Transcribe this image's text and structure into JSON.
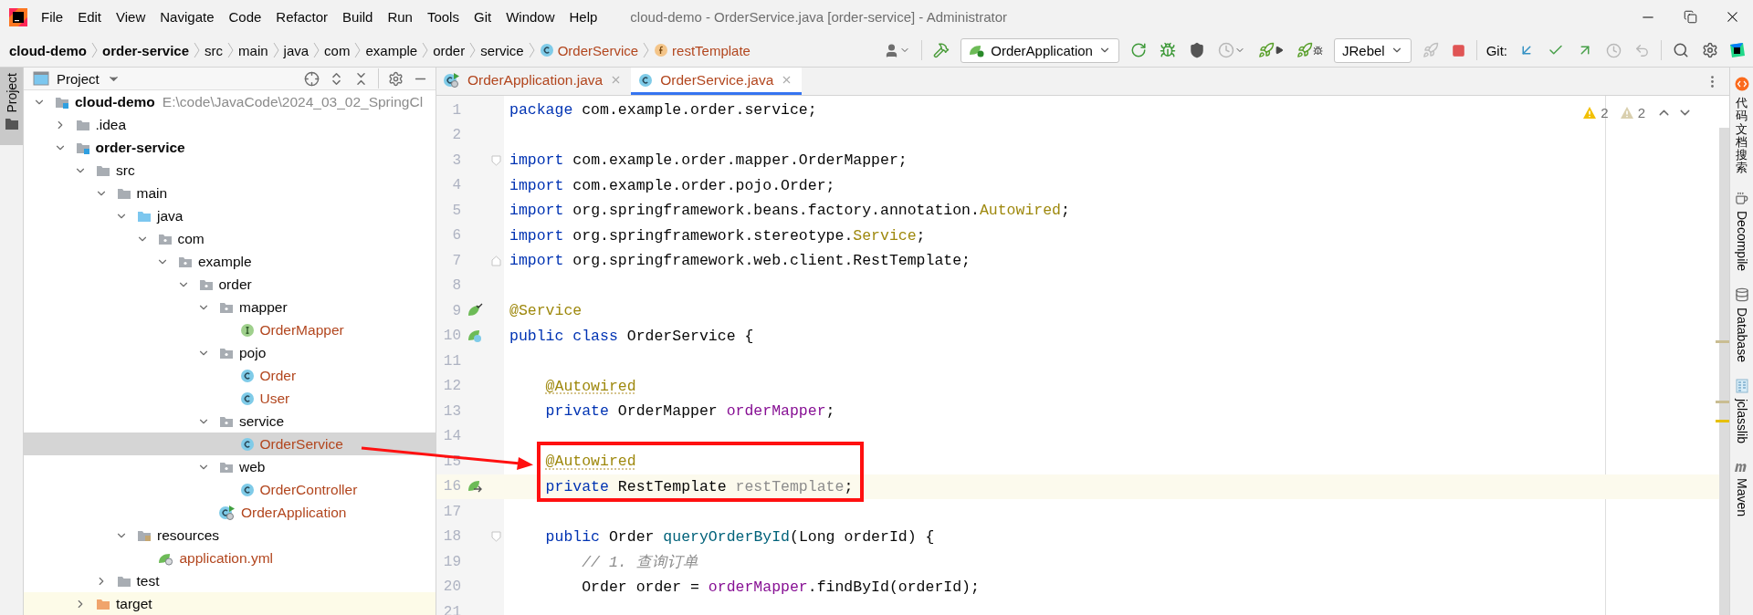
{
  "window": {
    "title": "cloud-demo - OrderService.java [order-service] - Administrator"
  },
  "menu": [
    "File",
    "Edit",
    "View",
    "Navigate",
    "Code",
    "Refactor",
    "Build",
    "Run",
    "Tools",
    "Git",
    "Window",
    "Help"
  ],
  "breadcrumbs": [
    {
      "label": "cloud-demo",
      "kind": "module"
    },
    {
      "label": "order-service",
      "kind": "module"
    },
    {
      "label": "src",
      "kind": "folder"
    },
    {
      "label": "main",
      "kind": "folder"
    },
    {
      "label": "java",
      "kind": "folder"
    },
    {
      "label": "com",
      "kind": "folder"
    },
    {
      "label": "example",
      "kind": "folder"
    },
    {
      "label": "order",
      "kind": "folder"
    },
    {
      "label": "service",
      "kind": "folder"
    },
    {
      "label": "OrderService",
      "kind": "class",
      "color": "#b2461e"
    },
    {
      "label": "restTemplate",
      "kind": "field",
      "color": "#b2461e"
    }
  ],
  "toolbar": {
    "run_config": "OrderApplication",
    "jrebel": "JRebel",
    "git_label": "Git:"
  },
  "left_stripe": [
    {
      "label": "Project",
      "selected": true
    }
  ],
  "project": {
    "title": "Project",
    "tree": [
      {
        "label": "cloud-demo",
        "kind": "module",
        "path": "E:\\code\\JavaCode\\2024_03_02_SpringCl",
        "expanded": true,
        "selected": false,
        "children": [
          {
            "label": ".idea",
            "kind": "folder",
            "expanded": false,
            "selected": false
          },
          {
            "label": "order-service",
            "kind": "module",
            "expanded": true,
            "selected": false,
            "children": [
              {
                "label": "src",
                "kind": "folder",
                "expanded": true,
                "selected": false,
                "children": [
                  {
                    "label": "main",
                    "kind": "folder",
                    "expanded": true,
                    "selected": false,
                    "children": [
                      {
                        "label": "java",
                        "kind": "source_root",
                        "expanded": true,
                        "selected": false,
                        "children": [
                          {
                            "label": "com",
                            "kind": "package",
                            "expanded": true,
                            "selected": false,
                            "children": [
                              {
                                "label": "example",
                                "kind": "package",
                                "expanded": true,
                                "selected": false,
                                "children": [
                                  {
                                    "label": "order",
                                    "kind": "package",
                                    "expanded": true,
                                    "selected": false,
                                    "children": [
                                      {
                                        "label": "mapper",
                                        "kind": "package",
                                        "expanded": true,
                                        "selected": false,
                                        "children": [
                                          {
                                            "label": "OrderMapper",
                                            "kind": "interface",
                                            "color": "#b2461e",
                                            "selected": false
                                          }
                                        ]
                                      },
                                      {
                                        "label": "pojo",
                                        "kind": "package",
                                        "expanded": true,
                                        "selected": false,
                                        "children": [
                                          {
                                            "label": "Order",
                                            "kind": "class",
                                            "color": "#b2461e",
                                            "selected": false
                                          },
                                          {
                                            "label": "User",
                                            "kind": "class",
                                            "color": "#b2461e",
                                            "selected": false
                                          }
                                        ]
                                      },
                                      {
                                        "label": "service",
                                        "kind": "package",
                                        "expanded": true,
                                        "selected": false,
                                        "children": [
                                          {
                                            "label": "OrderService",
                                            "kind": "class",
                                            "color": "#b2461e",
                                            "selected": true
                                          }
                                        ]
                                      },
                                      {
                                        "label": "web",
                                        "kind": "package",
                                        "expanded": true,
                                        "selected": false,
                                        "children": [
                                          {
                                            "label": "OrderController",
                                            "kind": "class",
                                            "color": "#b2461e",
                                            "selected": false
                                          }
                                        ]
                                      },
                                      {
                                        "label": "OrderApplication",
                                        "kind": "spring_app",
                                        "color": "#b2461e",
                                        "selected": false
                                      }
                                    ]
                                  }
                                ]
                              }
                            ]
                          }
                        ]
                      },
                      {
                        "label": "resources",
                        "kind": "resources",
                        "expanded": true,
                        "selected": false,
                        "children": [
                          {
                            "label": "application.yml",
                            "kind": "yml",
                            "color": "#b2461e",
                            "selected": false
                          }
                        ]
                      }
                    ]
                  },
                  {
                    "label": "test",
                    "kind": "folder",
                    "expanded": false,
                    "selected": false
                  }
                ]
              },
              {
                "label": "target",
                "kind": "excluded",
                "expanded": false,
                "selected": false
              }
            ]
          }
        ]
      }
    ]
  },
  "tabs": [
    {
      "label": "OrderApplication.java",
      "kind": "spring_app",
      "color": "#b2461e",
      "selected": false
    },
    {
      "label": "OrderService.java",
      "kind": "class",
      "color": "#b2461e",
      "selected": true
    }
  ],
  "inspections": [
    {
      "kind": "warning",
      "count": "2"
    },
    {
      "kind": "weak_warning",
      "count": "2"
    }
  ],
  "code": [
    {
      "n": "1",
      "tokens": [
        {
          "kind": "keyword",
          "text": "package"
        },
        {
          "kind": "plain",
          "text": " com.example.order.service;"
        }
      ]
    },
    {
      "n": "2"
    },
    {
      "n": "3",
      "fold": {
        "kind": "start"
      },
      "tokens": [
        {
          "kind": "keyword",
          "text": "import"
        },
        {
          "kind": "plain",
          "text": " com.example.order.mapper.OrderMapper;"
        }
      ]
    },
    {
      "n": "4",
      "tokens": [
        {
          "kind": "keyword",
          "text": "import"
        },
        {
          "kind": "plain",
          "text": " com.example.order.pojo.Order;"
        }
      ]
    },
    {
      "n": "5",
      "tokens": [
        {
          "kind": "keyword",
          "text": "import"
        },
        {
          "kind": "plain",
          "text": " org.springframework.beans.factory.annotation."
        },
        {
          "kind": "annotation",
          "text": "Autowired"
        },
        {
          "kind": "plain",
          "text": ";"
        }
      ]
    },
    {
      "n": "6",
      "tokens": [
        {
          "kind": "keyword",
          "text": "import"
        },
        {
          "kind": "plain",
          "text": " org.springframework.stereotype."
        },
        {
          "kind": "annotation",
          "text": "Service"
        },
        {
          "kind": "plain",
          "text": ";"
        }
      ]
    },
    {
      "n": "7",
      "fold": {
        "kind": "end"
      },
      "tokens": [
        {
          "kind": "keyword",
          "text": "import"
        },
        {
          "kind": "plain",
          "text": " org.springframework.web.client.RestTemplate;"
        }
      ]
    },
    {
      "n": "8"
    },
    {
      "n": "9",
      "gutter": {
        "kind": "bean"
      },
      "tokens": [
        {
          "kind": "annotation",
          "text": "@Service"
        }
      ]
    },
    {
      "n": "10",
      "gutter": {
        "kind": "bean_class"
      },
      "tokens": [
        {
          "kind": "keyword",
          "text": "public class"
        },
        {
          "kind": "plain",
          "text": " OrderService {"
        }
      ]
    },
    {
      "n": "11"
    },
    {
      "n": "12",
      "tokens": [
        {
          "kind": "annotation_warn",
          "text": "    @Autowired"
        }
      ]
    },
    {
      "n": "13",
      "tokens": [
        {
          "kind": "keyword",
          "text": "    private"
        },
        {
          "kind": "plain",
          "text": " OrderMapper "
        },
        {
          "kind": "field",
          "text": "orderMapper"
        },
        {
          "kind": "plain",
          "text": ";"
        }
      ]
    },
    {
      "n": "14"
    },
    {
      "n": "15",
      "tokens": [
        {
          "kind": "annotation_warn",
          "text": "    @Autowired"
        }
      ]
    },
    {
      "n": "16",
      "gutter": {
        "kind": "autowired"
      },
      "current": true,
      "tokens": [
        {
          "kind": "keyword",
          "text": "    private"
        },
        {
          "kind": "plain",
          "text": " RestTemplate "
        },
        {
          "kind": "unused",
          "text": "restTemplate"
        },
        {
          "kind": "plain",
          "text": ";"
        }
      ]
    },
    {
      "n": "17"
    },
    {
      "n": "18",
      "fold": {
        "kind": "start"
      },
      "tokens": [
        {
          "kind": "keyword",
          "text": "    public"
        },
        {
          "kind": "plain",
          "text": " Order "
        },
        {
          "kind": "method",
          "text": "queryOrderById"
        },
        {
          "kind": "plain",
          "text": "(Long orderId) {"
        }
      ]
    },
    {
      "n": "19",
      "tokens": [
        {
          "kind": "comment",
          "text": "        // 1. 查询订单"
        }
      ]
    },
    {
      "n": "20",
      "tokens": [
        {
          "kind": "plain",
          "text": "        Order order = "
        },
        {
          "kind": "field",
          "text": "orderMapper"
        },
        {
          "kind": "plain",
          "text": ".findById(orderId);"
        }
      ]
    },
    {
      "n": "21"
    }
  ],
  "right_stripe": [
    {
      "label": "代码文档搜索",
      "kind": "doc_search",
      "upright": true
    },
    {
      "label": "Decompile",
      "kind": "decompile",
      "upright": false
    },
    {
      "label": "Database",
      "kind": "database",
      "upright": false
    },
    {
      "label": "jclasslib",
      "kind": "jclasslib",
      "upright": false
    },
    {
      "label": "Maven",
      "kind": "maven",
      "upright": false
    }
  ]
}
